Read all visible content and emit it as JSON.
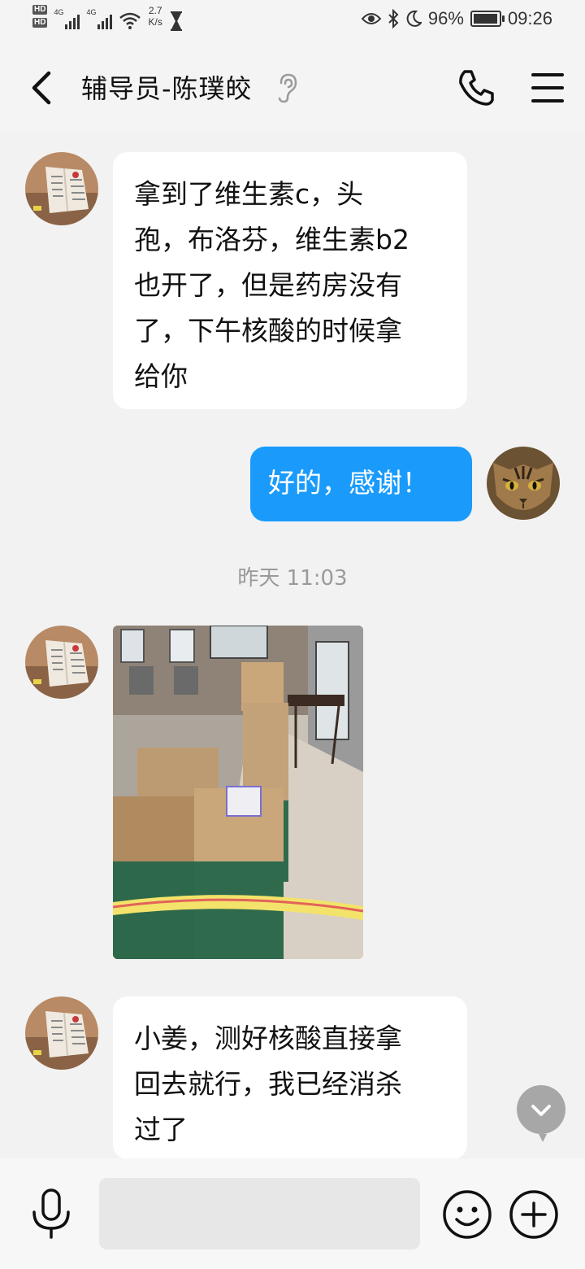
{
  "status": {
    "hd1": "HD",
    "hd2": "HD",
    "net1": "4G",
    "net2": "4G",
    "speed_value": "2.7",
    "speed_unit": "K/s",
    "battery_pct": "96%",
    "battery_level": 0.96,
    "time": "09:26"
  },
  "header": {
    "title": "辅导员-陈璞皎"
  },
  "messages": [
    {
      "sender": "other",
      "type": "text",
      "lines": [
        "拿到了维生素c，头",
        "孢，布洛芬，维生素b2",
        "也开了，但是药房没有",
        "了，下午核酸的时候拿",
        "给你"
      ]
    },
    {
      "sender": "me",
      "type": "text",
      "lines": [
        "好的，感谢！"
      ]
    },
    {
      "type": "timestamp",
      "text": "昨天 11:03"
    },
    {
      "sender": "other",
      "type": "image"
    },
    {
      "sender": "other",
      "type": "text",
      "lines": [
        "小姜，测好核酸直接拿",
        "回去就行，我已经消杀",
        "过了"
      ]
    }
  ],
  "icons": {
    "back": "back-arrow-icon",
    "ear": "earpiece-icon",
    "phone": "phone-icon",
    "menu": "menu-icon",
    "mic": "microphone-icon",
    "emoji": "emoji-icon",
    "plus": "plus-icon",
    "scroll": "chevron-down-icon"
  },
  "colors": {
    "my_bubble": "#1a9bfc",
    "other_bubble": "#ffffff",
    "background": "#f2f2f2"
  }
}
